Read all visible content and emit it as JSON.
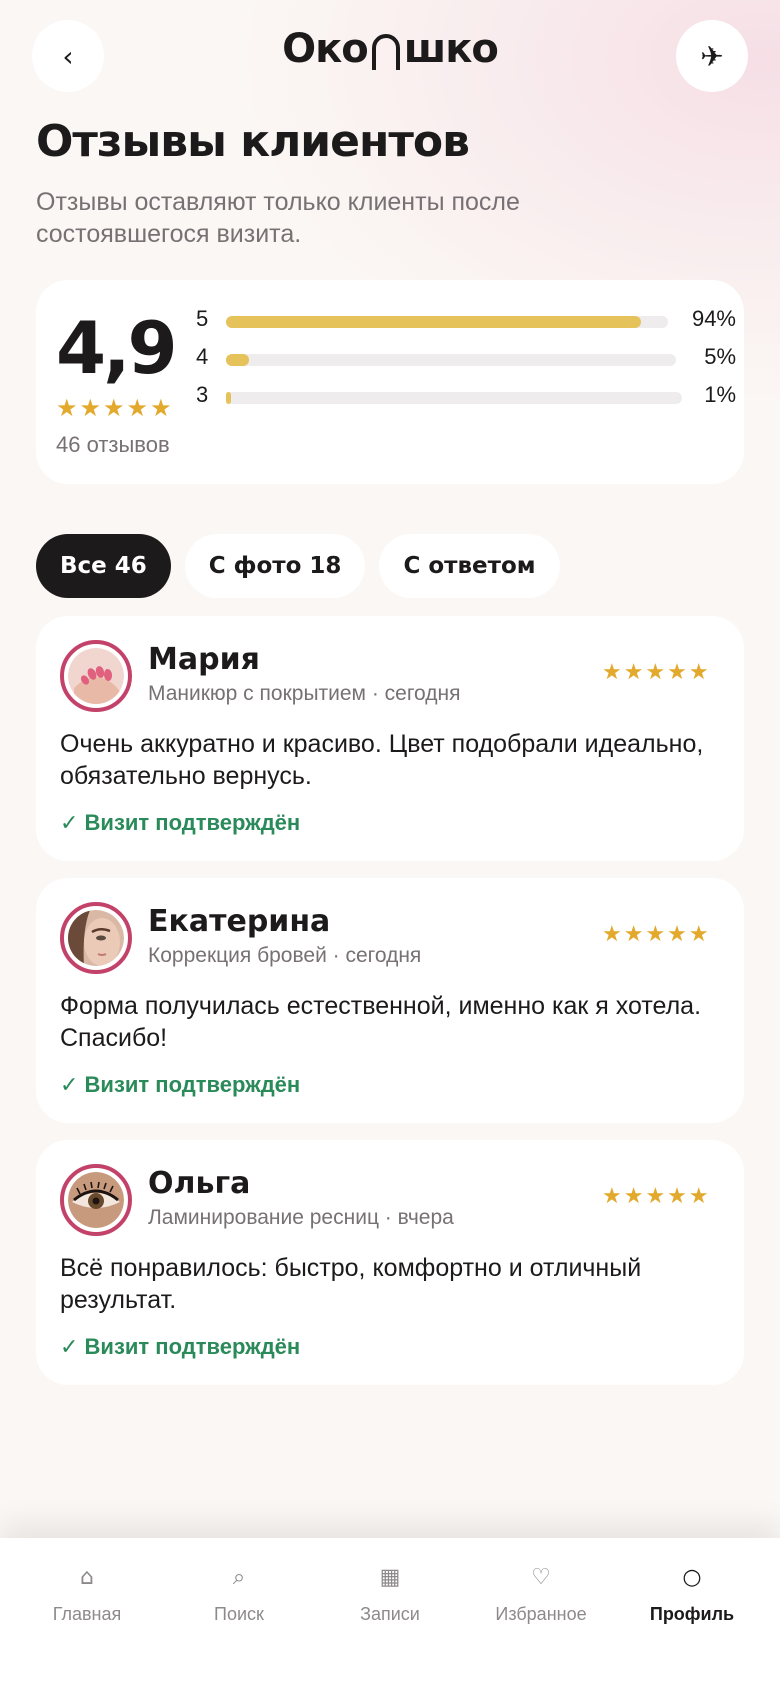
{
  "header": {
    "back_icon": "‹",
    "logo_left": "Око",
    "logo_right": "шко",
    "share_icon": "✈"
  },
  "page": {
    "title": "Отзывы клиентов",
    "subtitle": "Отзывы оставляют только клиенты после состоявшегося визита."
  },
  "summary": {
    "rating": "4,9",
    "stars": "★★★★★",
    "count_label": "46 отзывов",
    "distribution": [
      {
        "stars": "5",
        "percent_label": "94%",
        "fraction": 0.94
      },
      {
        "stars": "4",
        "percent_label": "5%",
        "fraction": 0.05
      },
      {
        "stars": "3",
        "percent_label": "1%",
        "fraction": 0.01
      }
    ],
    "bar_color": "#e6c35a"
  },
  "filters": [
    {
      "label": "Все 46",
      "active": true
    },
    {
      "label": "С фото 18",
      "active": false
    },
    {
      "label": "С ответом",
      "active": false
    }
  ],
  "reviews": [
    {
      "name": "Мария",
      "meta": "Маникюр с покрытием · сегодня",
      "stars": "★★★★★",
      "text": "Очень аккуратно и красиво. Цвет подобрали идеально, обязательно вернусь.",
      "verified": "✓ Визит подтверждён"
    },
    {
      "name": "Екатерина",
      "meta": "Коррекция бровей · сегодня",
      "stars": "★★★★★",
      "text": "Форма получилась естественной, именно как я хотела. Спасибо!",
      "verified": "✓ Визит подтверждён"
    },
    {
      "name": "Ольга",
      "meta": "Ламинирование ресниц · вчера",
      "stars": "★★★★★",
      "text": "Всё понравилось: быстро, комфортно и отличный результат.",
      "verified": "✓ Визит подтверждён"
    }
  ],
  "nav": [
    {
      "icon": "⌂",
      "label": "Главная",
      "active": false
    },
    {
      "icon": "⌕",
      "label": "Поиск",
      "active": false
    },
    {
      "icon": "▦",
      "label": "Записи",
      "active": false
    },
    {
      "icon": "♡",
      "label": "Избранное",
      "active": false
    },
    {
      "icon": "○",
      "label": "Профиль",
      "active": true
    }
  ],
  "colors": {
    "accent_dark": "#1c1a1b",
    "star": "#e2a92d",
    "verified": "#2a8a5a",
    "avatar_ring": "#c3426a"
  }
}
